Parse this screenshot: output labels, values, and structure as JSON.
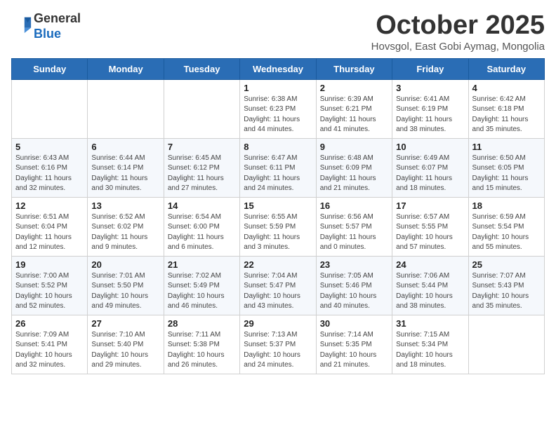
{
  "header": {
    "logo_general": "General",
    "logo_blue": "Blue",
    "month": "October 2025",
    "location": "Hovsgol, East Gobi Aymag, Mongolia"
  },
  "days_of_week": [
    "Sunday",
    "Monday",
    "Tuesday",
    "Wednesday",
    "Thursday",
    "Friday",
    "Saturday"
  ],
  "weeks": [
    [
      {
        "day": "",
        "info": ""
      },
      {
        "day": "",
        "info": ""
      },
      {
        "day": "",
        "info": ""
      },
      {
        "day": "1",
        "info": "Sunrise: 6:38 AM\nSunset: 6:23 PM\nDaylight: 11 hours and 44 minutes."
      },
      {
        "day": "2",
        "info": "Sunrise: 6:39 AM\nSunset: 6:21 PM\nDaylight: 11 hours and 41 minutes."
      },
      {
        "day": "3",
        "info": "Sunrise: 6:41 AM\nSunset: 6:19 PM\nDaylight: 11 hours and 38 minutes."
      },
      {
        "day": "4",
        "info": "Sunrise: 6:42 AM\nSunset: 6:18 PM\nDaylight: 11 hours and 35 minutes."
      }
    ],
    [
      {
        "day": "5",
        "info": "Sunrise: 6:43 AM\nSunset: 6:16 PM\nDaylight: 11 hours and 32 minutes."
      },
      {
        "day": "6",
        "info": "Sunrise: 6:44 AM\nSunset: 6:14 PM\nDaylight: 11 hours and 30 minutes."
      },
      {
        "day": "7",
        "info": "Sunrise: 6:45 AM\nSunset: 6:12 PM\nDaylight: 11 hours and 27 minutes."
      },
      {
        "day": "8",
        "info": "Sunrise: 6:47 AM\nSunset: 6:11 PM\nDaylight: 11 hours and 24 minutes."
      },
      {
        "day": "9",
        "info": "Sunrise: 6:48 AM\nSunset: 6:09 PM\nDaylight: 11 hours and 21 minutes."
      },
      {
        "day": "10",
        "info": "Sunrise: 6:49 AM\nSunset: 6:07 PM\nDaylight: 11 hours and 18 minutes."
      },
      {
        "day": "11",
        "info": "Sunrise: 6:50 AM\nSunset: 6:05 PM\nDaylight: 11 hours and 15 minutes."
      }
    ],
    [
      {
        "day": "12",
        "info": "Sunrise: 6:51 AM\nSunset: 6:04 PM\nDaylight: 11 hours and 12 minutes."
      },
      {
        "day": "13",
        "info": "Sunrise: 6:52 AM\nSunset: 6:02 PM\nDaylight: 11 hours and 9 minutes."
      },
      {
        "day": "14",
        "info": "Sunrise: 6:54 AM\nSunset: 6:00 PM\nDaylight: 11 hours and 6 minutes."
      },
      {
        "day": "15",
        "info": "Sunrise: 6:55 AM\nSunset: 5:59 PM\nDaylight: 11 hours and 3 minutes."
      },
      {
        "day": "16",
        "info": "Sunrise: 6:56 AM\nSunset: 5:57 PM\nDaylight: 11 hours and 0 minutes."
      },
      {
        "day": "17",
        "info": "Sunrise: 6:57 AM\nSunset: 5:55 PM\nDaylight: 10 hours and 57 minutes."
      },
      {
        "day": "18",
        "info": "Sunrise: 6:59 AM\nSunset: 5:54 PM\nDaylight: 10 hours and 55 minutes."
      }
    ],
    [
      {
        "day": "19",
        "info": "Sunrise: 7:00 AM\nSunset: 5:52 PM\nDaylight: 10 hours and 52 minutes."
      },
      {
        "day": "20",
        "info": "Sunrise: 7:01 AM\nSunset: 5:50 PM\nDaylight: 10 hours and 49 minutes."
      },
      {
        "day": "21",
        "info": "Sunrise: 7:02 AM\nSunset: 5:49 PM\nDaylight: 10 hours and 46 minutes."
      },
      {
        "day": "22",
        "info": "Sunrise: 7:04 AM\nSunset: 5:47 PM\nDaylight: 10 hours and 43 minutes."
      },
      {
        "day": "23",
        "info": "Sunrise: 7:05 AM\nSunset: 5:46 PM\nDaylight: 10 hours and 40 minutes."
      },
      {
        "day": "24",
        "info": "Sunrise: 7:06 AM\nSunset: 5:44 PM\nDaylight: 10 hours and 38 minutes."
      },
      {
        "day": "25",
        "info": "Sunrise: 7:07 AM\nSunset: 5:43 PM\nDaylight: 10 hours and 35 minutes."
      }
    ],
    [
      {
        "day": "26",
        "info": "Sunrise: 7:09 AM\nSunset: 5:41 PM\nDaylight: 10 hours and 32 minutes."
      },
      {
        "day": "27",
        "info": "Sunrise: 7:10 AM\nSunset: 5:40 PM\nDaylight: 10 hours and 29 minutes."
      },
      {
        "day": "28",
        "info": "Sunrise: 7:11 AM\nSunset: 5:38 PM\nDaylight: 10 hours and 26 minutes."
      },
      {
        "day": "29",
        "info": "Sunrise: 7:13 AM\nSunset: 5:37 PM\nDaylight: 10 hours and 24 minutes."
      },
      {
        "day": "30",
        "info": "Sunrise: 7:14 AM\nSunset: 5:35 PM\nDaylight: 10 hours and 21 minutes."
      },
      {
        "day": "31",
        "info": "Sunrise: 7:15 AM\nSunset: 5:34 PM\nDaylight: 10 hours and 18 minutes."
      },
      {
        "day": "",
        "info": ""
      }
    ]
  ]
}
